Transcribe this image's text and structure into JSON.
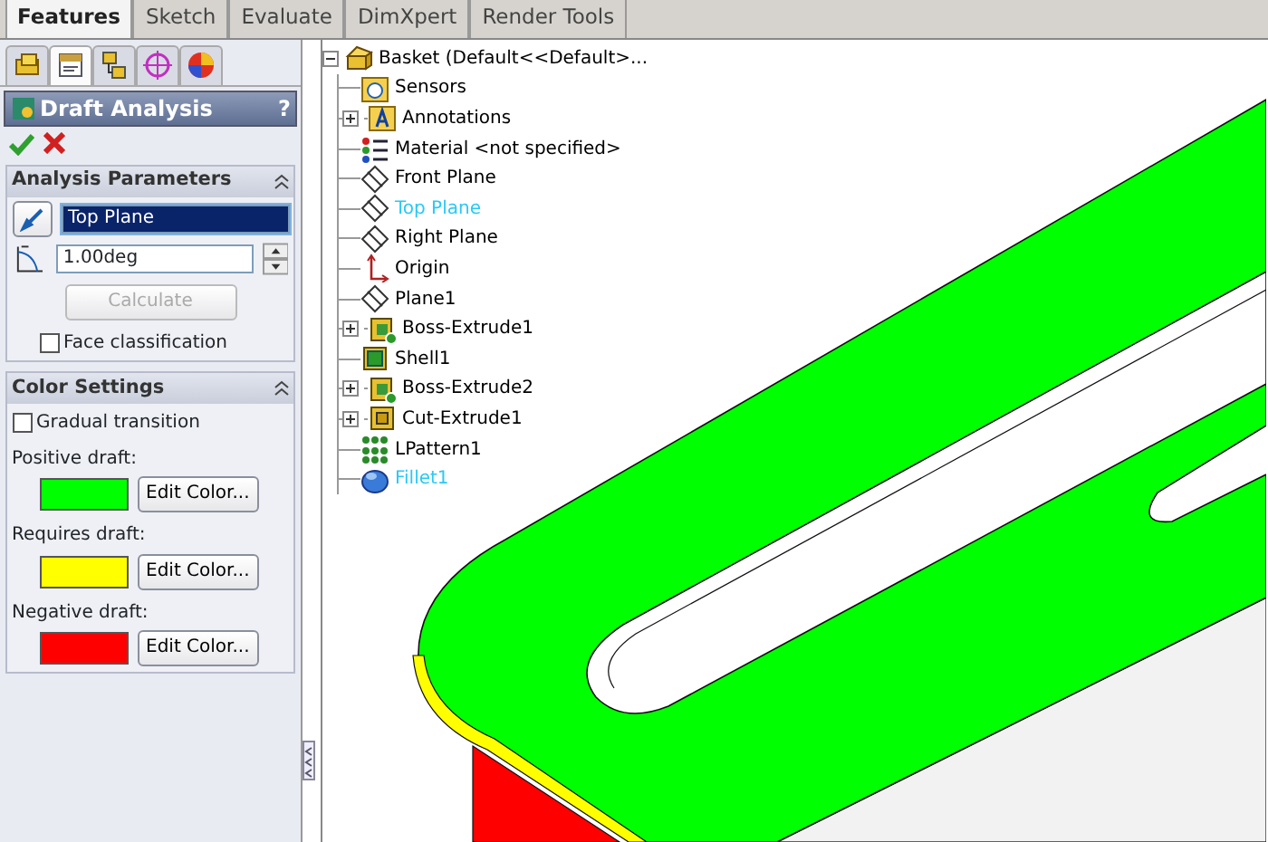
{
  "command_tabs": [
    {
      "label": "Features",
      "selected": true
    },
    {
      "label": "Sketch",
      "selected": false
    },
    {
      "label": "Evaluate",
      "selected": false
    },
    {
      "label": "DimXpert",
      "selected": false
    },
    {
      "label": "Render Tools",
      "selected": false
    }
  ],
  "panel_tabs": [
    {
      "kind": "tree",
      "selected": false
    },
    {
      "kind": "property",
      "selected": true
    },
    {
      "kind": "config",
      "selected": false
    },
    {
      "kind": "target",
      "selected": false
    },
    {
      "kind": "appearance",
      "selected": false
    }
  ],
  "property_manager": {
    "title": "Draft Analysis",
    "help": "?",
    "groups": [
      {
        "title": "Analysis Parameters",
        "expanded": true,
        "kind": "parameters",
        "direction": {
          "value": "Top Plane",
          "highlighted": true
        },
        "angle": {
          "value": "1.00deg"
        },
        "calculate": {
          "label": "Calculate",
          "disabled": true
        },
        "face_classification": {
          "label": "Face classification",
          "checked": false
        }
      },
      {
        "title": "Color Settings",
        "expanded": true,
        "kind": "colors",
        "gradual": {
          "label": "Gradual transition",
          "checked": false
        },
        "colors": [
          {
            "label": "Positive draft:",
            "color": "#00ff00",
            "button": "Edit Color..."
          },
          {
            "label": "Requires draft:",
            "color": "#ffff00",
            "button": "Edit Color..."
          },
          {
            "label": "Negative draft:",
            "color": "#ff0000",
            "button": "Edit Color..."
          }
        ]
      }
    ]
  },
  "feature_tree": {
    "label": "Basket  (Default<<Default>...",
    "kind": "part",
    "expanded": true,
    "selected": false,
    "children": [
      {
        "label": "Sensors",
        "kind": "sensors",
        "selected": false
      },
      {
        "label": "Annotations",
        "kind": "annotations",
        "selected": false,
        "expanded": false
      },
      {
        "label": "Material <not specified>",
        "kind": "material",
        "selected": false
      },
      {
        "label": "Front Plane",
        "kind": "plane",
        "selected": false
      },
      {
        "label": "Top Plane",
        "kind": "plane",
        "selected": true
      },
      {
        "label": "Right Plane",
        "kind": "plane",
        "selected": false
      },
      {
        "label": "Origin",
        "kind": "origin",
        "selected": false
      },
      {
        "label": "Plane1",
        "kind": "plane",
        "selected": false
      },
      {
        "label": "Boss-Extrude1",
        "kind": "extrude",
        "selected": false,
        "expanded": false
      },
      {
        "label": "Shell1",
        "kind": "shell",
        "selected": false
      },
      {
        "label": "Boss-Extrude2",
        "kind": "extrude",
        "selected": false,
        "expanded": false
      },
      {
        "label": "Cut-Extrude1",
        "kind": "cut",
        "selected": false,
        "expanded": false
      },
      {
        "label": "LPattern1",
        "kind": "pattern",
        "selected": false
      },
      {
        "label": "Fillet1",
        "kind": "fillet",
        "selected": true
      }
    ]
  }
}
